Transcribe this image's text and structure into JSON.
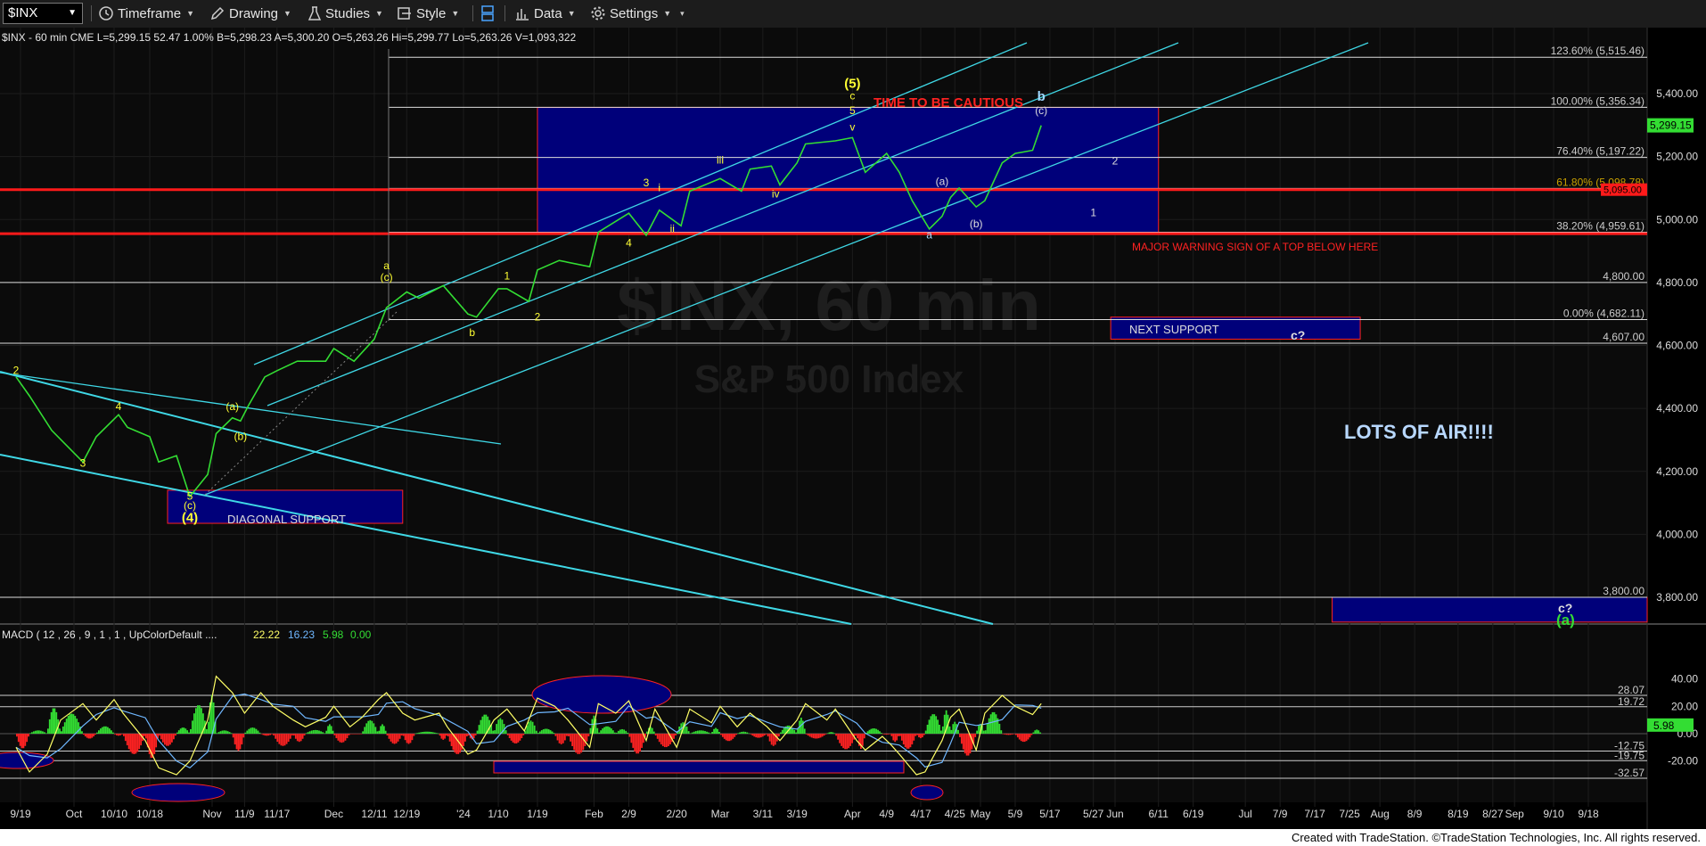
{
  "toolbar": {
    "symbol": "$INX",
    "timeframe_label": "Timeframe",
    "drawing_label": "Drawing",
    "studies_label": "Studies",
    "style_label": "Style",
    "data_label": "Data",
    "settings_label": "Settings",
    "icons": [
      "clock-icon",
      "pencil-icon",
      "flask-icon",
      "style-icon",
      "layout-icon",
      "bar-chart-icon",
      "gear-icon"
    ]
  },
  "header": {
    "info_line": "$INX - 60 min  CME  L=5,299.15  52.47  1.00%  B=5,298.23  A=5,300.20  O=5,263.26  Hi=5,299.77  Lo=5,263.26  V=1,093,322"
  },
  "watermark": {
    "symbol": "$INX, 60 min",
    "name": "S&P 500 Index"
  },
  "chart_data": [
    {
      "type": "line",
      "title": "$INX - 60 min",
      "colors": {
        "price": "#33dd33",
        "fib_line": "#dddddd",
        "channel": "#3fd8e6",
        "support_line": "#ff1a1a",
        "box_fill": "#00007a",
        "box_border": "#ff2222"
      },
      "x_tick_labels": [
        "9/19",
        "Oct",
        "10/10",
        "10/18",
        "Nov",
        "11/9",
        "11/17",
        "Dec",
        "12/11",
        "12/19",
        "'24",
        "1/10",
        "1/19",
        "Feb",
        "2/9",
        "2/20",
        "Mar",
        "3/11",
        "3/19",
        "Apr",
        "4/9",
        "4/17",
        "4/25",
        "May",
        "5/9",
        "5/17",
        "5/27",
        "Jun",
        "6/11",
        "6/19",
        "Jul",
        "7/9",
        "7/17",
        "7/25",
        "Aug",
        "8/9",
        "8/19",
        "8/27",
        "Sep",
        "9/10",
        "9/18"
      ],
      "y_axis_labels": [
        "5,400.00",
        "5,200.00",
        "5,000.00",
        "4,800.00",
        "4,600.00",
        "4,400.00",
        "4,200.00",
        "4,000.00",
        "3,800.00"
      ],
      "ylim": [
        3720,
        5600
      ],
      "last_price": 5299.15,
      "last_price_label": "5,299.15",
      "fib_levels": [
        {
          "value": 5515.46,
          "label": "123.60% (5,515.46)"
        },
        {
          "value": 5356.34,
          "label": "100.00% (5,356.34)"
        },
        {
          "value": 5197.22,
          "label": "76.40% (5,197.22)"
        },
        {
          "value": 5098.78,
          "label": "61.80% (5,098.78)"
        },
        {
          "value": 4959.61,
          "label": "38.20% (4,959.61)"
        },
        {
          "value": 4682.11,
          "label": "0.00% (4,682.11)"
        }
      ],
      "level_labels": [
        {
          "value": 4800,
          "label": "4,800.00"
        },
        {
          "value": 4607,
          "label": "4,607.00"
        },
        {
          "value": 3800,
          "label": "3,800.00"
        }
      ],
      "red_support_lines": [
        5095,
        4955
      ],
      "red_line_tag": "5,095.00",
      "wave_labels": [
        {
          "text": "(5)",
          "date": "4/1",
          "y": 5418,
          "color": "#ffff33"
        },
        {
          "text": "c",
          "date": "4/1",
          "y": 5382,
          "color": "#ffff33"
        },
        {
          "text": "5",
          "date": "4/1",
          "y": 5335,
          "color": "#ffff33"
        },
        {
          "text": "v",
          "date": "4/1",
          "y": 5282,
          "color": "#ffff33"
        },
        {
          "text": "iii",
          "date": "3/1",
          "y": 5178,
          "color": "#ffff33"
        },
        {
          "text": "iv",
          "date": "3/14",
          "y": 5070,
          "color": "#ffff33"
        },
        {
          "text": "i",
          "date": "2/16",
          "y": 5090,
          "color": "#ffff33"
        },
        {
          "text": "3",
          "date": "2/13",
          "y": 5105,
          "color": "#ffff33"
        },
        {
          "text": "4",
          "date": "2/9",
          "y": 4915,
          "color": "#ffff33"
        },
        {
          "text": "ii",
          "date": "2/19",
          "y": 4960,
          "color": "#ffff33"
        },
        {
          "text": "1",
          "date": "1/12",
          "y": 4810,
          "color": "#ffff33"
        },
        {
          "text": "2",
          "date": "1/19",
          "y": 4680,
          "color": "#ffff33"
        },
        {
          "text": "a",
          "date": "12/14",
          "y": 4842,
          "color": "#ffff33"
        },
        {
          "text": "(c)",
          "date": "12/14",
          "y": 4805,
          "color": "#ffff33"
        },
        {
          "text": "b",
          "date": "1/4",
          "y": 4630,
          "color": "#ffff33"
        },
        {
          "text": "(a)",
          "date": "11/6",
          "y": 4395,
          "color": "#ffff33"
        },
        {
          "text": "(b)",
          "date": "11/8",
          "y": 4300,
          "color": "#ffff33"
        },
        {
          "text": "4",
          "date": "10/11",
          "y": 4395,
          "color": "#ffff33"
        },
        {
          "text": "3",
          "date": "10/3",
          "y": 4215,
          "color": "#ffff33"
        },
        {
          "text": "2",
          "date": "9/18",
          "y": 4510,
          "color": "#ffff33"
        },
        {
          "text": "5",
          "date": "10/27",
          "y": 4110,
          "color": "#ffff33"
        },
        {
          "text": "(c)",
          "date": "10/27",
          "y": 4080,
          "color": "#ffff33"
        },
        {
          "text": "(4)",
          "date": "10/27",
          "y": 4040,
          "color": "#ffff33"
        },
        {
          "text": "a",
          "date": "4/19",
          "y": 4940,
          "color": "#9fd8ff"
        },
        {
          "text": "(a)",
          "date": "4/22",
          "y": 5110,
          "color": "#dddddd"
        },
        {
          "text": "(b)",
          "date": "4/30",
          "y": 4975,
          "color": "#dddddd"
        },
        {
          "text": "(c)",
          "date": "5/15",
          "y": 5335,
          "color": "#dddddd"
        },
        {
          "text": "b",
          "date": "5/15",
          "y": 5378,
          "color": "#9fd8ff"
        },
        {
          "text": "2",
          "date": "6/1",
          "y": 5175,
          "color": "#dddddd"
        },
        {
          "text": "1",
          "date": "5/27",
          "y": 5010,
          "color": "#dddddd"
        }
      ],
      "annotations": [
        {
          "text": "TIME TO BE CAUTIOUS",
          "color": "#ff2222"
        },
        {
          "text": "MAJOR WARNING SIGN OF A TOP BELOW HERE",
          "color": "#ff2222"
        },
        {
          "text": "NEXT SUPPORT",
          "color": "#dddddd"
        },
        {
          "text": "c?",
          "color": "#dddddd"
        },
        {
          "text": "LOTS OF AIR!!!!",
          "color": "#b8d8ff"
        },
        {
          "text": "DIAGONAL SUPPORT",
          "color": "#dddddd"
        },
        {
          "text": "c?",
          "color": "#dddddd"
        },
        {
          "text": "(a)",
          "color": "#33dd33"
        }
      ],
      "price_points": [
        [
          "9/18",
          4500
        ],
        [
          "9/21",
          4440
        ],
        [
          "9/26",
          4330
        ],
        [
          "10/3",
          4230
        ],
        [
          "10/6",
          4310
        ],
        [
          "10/11",
          4380
        ],
        [
          "10/13",
          4340
        ],
        [
          "10/18",
          4310
        ],
        [
          "10/20",
          4230
        ],
        [
          "10/24",
          4250
        ],
        [
          "10/27",
          4120
        ],
        [
          "10/31",
          4190
        ],
        [
          "11/2",
          4320
        ],
        [
          "11/6",
          4370
        ],
        [
          "11/8",
          4360
        ],
        [
          "11/10",
          4410
        ],
        [
          "11/14",
          4500
        ],
        [
          "11/17",
          4520
        ],
        [
          "11/22",
          4550
        ],
        [
          "11/29",
          4550
        ],
        [
          "12/1",
          4590
        ],
        [
          "12/6",
          4550
        ],
        [
          "12/11",
          4620
        ],
        [
          "12/14",
          4720
        ],
        [
          "12/19",
          4770
        ],
        [
          "12/22",
          4750
        ],
        [
          "12/28",
          4790
        ],
        [
          "1/3",
          4700
        ],
        [
          "1/5",
          4690
        ],
        [
          "1/10",
          4780
        ],
        [
          "1/12",
          4780
        ],
        [
          "1/17",
          4740
        ],
        [
          "1/19",
          4840
        ],
        [
          "1/24",
          4870
        ],
        [
          "1/31",
          4850
        ],
        [
          "2/2",
          4960
        ],
        [
          "2/9",
          5020
        ],
        [
          "2/13",
          4950
        ],
        [
          "2/16",
          5030
        ],
        [
          "2/21",
          4980
        ],
        [
          "2/23",
          5090
        ],
        [
          "3/1",
          5130
        ],
        [
          "3/6",
          5090
        ],
        [
          "3/8",
          5160
        ],
        [
          "3/13",
          5170
        ],
        [
          "3/15",
          5110
        ],
        [
          "3/19",
          5180
        ],
        [
          "3/21",
          5240
        ],
        [
          "3/28",
          5250
        ],
        [
          "4/1",
          5260
        ],
        [
          "4/4",
          5150
        ],
        [
          "4/9",
          5210
        ],
        [
          "4/12",
          5150
        ],
        [
          "4/15",
          5060
        ],
        [
          "4/19",
          4970
        ],
        [
          "4/22",
          5010
        ],
        [
          "4/24",
          5070
        ],
        [
          "4/26",
          5100
        ],
        [
          "4/30",
          5040
        ],
        [
          "5/2",
          5060
        ],
        [
          "5/6",
          5180
        ],
        [
          "5/9",
          5210
        ],
        [
          "5/13",
          5220
        ],
        [
          "5/15",
          5299
        ]
      ]
    },
    {
      "type": "line",
      "title": "MACD ( 12 , 26 , 9 , 1 , 1 , UpColorDefault ....",
      "legend_values": [
        {
          "text": "22.22",
          "color": "#ffff66"
        },
        {
          "text": "16.23",
          "color": "#6fb7ff"
        },
        {
          "text": "5.98",
          "color": "#33dd33"
        },
        {
          "text": "0.00",
          "color": "#33dd33"
        }
      ],
      "y_axis_labels": [
        "40.00",
        "20.00",
        "0.00",
        "-20.00"
      ],
      "ylim": [
        -32,
        46
      ],
      "level_labels": [
        {
          "value": 28.07,
          "label": "28.07"
        },
        {
          "value": 19.72,
          "label": "19.72"
        },
        {
          "value": -12.75,
          "label": "-12.75"
        },
        {
          "value": -19.75,
          "label": "-19.75"
        },
        {
          "value": -32.57,
          "label": "-32.57"
        }
      ],
      "current_value_label": "5.98",
      "series": [
        {
          "name": "MACD",
          "color": "#ffff66"
        },
        {
          "name": "Signal",
          "color": "#6fb7ff"
        },
        {
          "name": "Histogram",
          "color": "#33dd33"
        }
      ],
      "macd_points": [
        [
          "9/18",
          -10
        ],
        [
          "9/21",
          -28
        ],
        [
          "9/25",
          -15
        ],
        [
          "9/28",
          10
        ],
        [
          "10/3",
          22
        ],
        [
          "10/6",
          10
        ],
        [
          "10/10",
          25
        ],
        [
          "10/12",
          15
        ],
        [
          "10/17",
          -5
        ],
        [
          "10/20",
          -25
        ],
        [
          "10/24",
          -30
        ],
        [
          "10/27",
          -20
        ],
        [
          "10/31",
          10
        ],
        [
          "11/2",
          42
        ],
        [
          "11/6",
          30
        ],
        [
          "11/9",
          15
        ],
        [
          "11/13",
          30
        ],
        [
          "11/16",
          20
        ],
        [
          "11/21",
          10
        ],
        [
          "11/24",
          5
        ],
        [
          "11/29",
          12
        ],
        [
          "12/1",
          20
        ],
        [
          "12/5",
          5
        ],
        [
          "12/8",
          12
        ],
        [
          "12/12",
          25
        ],
        [
          "12/14",
          30
        ],
        [
          "12/18",
          15
        ],
        [
          "12/21",
          10
        ],
        [
          "12/27",
          15
        ],
        [
          "12/29",
          5
        ],
        [
          "1/3",
          -15
        ],
        [
          "1/5",
          -12
        ],
        [
          "1/9",
          10
        ],
        [
          "1/12",
          18
        ],
        [
          "1/16",
          2
        ],
        [
          "1/19",
          26
        ],
        [
          "1/23",
          20
        ],
        [
          "1/26",
          10
        ],
        [
          "1/31",
          -10
        ],
        [
          "2/2",
          22
        ],
        [
          "2/6",
          15
        ],
        [
          "2/9",
          24
        ],
        [
          "2/13",
          -5
        ],
        [
          "2/15",
          18
        ],
        [
          "2/20",
          -10
        ],
        [
          "2/23",
          18
        ],
        [
          "2/28",
          8
        ],
        [
          "3/1",
          20
        ],
        [
          "3/5",
          5
        ],
        [
          "3/8",
          15
        ],
        [
          "3/12",
          5
        ],
        [
          "3/15",
          -5
        ],
        [
          "3/19",
          10
        ],
        [
          "3/21",
          22
        ],
        [
          "3/26",
          10
        ],
        [
          "3/28",
          18
        ],
        [
          "4/2",
          -5
        ],
        [
          "4/4",
          -12
        ],
        [
          "4/8",
          -2
        ],
        [
          "4/10",
          -8
        ],
        [
          "4/12",
          -15
        ],
        [
          "4/16",
          -30
        ],
        [
          "4/18",
          -28
        ],
        [
          "4/22",
          -5
        ],
        [
          "4/24",
          12
        ],
        [
          "4/26",
          18
        ],
        [
          "4/30",
          -12
        ],
        [
          "5/2",
          15
        ],
        [
          "5/6",
          28
        ],
        [
          "5/9",
          20
        ],
        [
          "5/13",
          14
        ],
        [
          "5/15",
          22
        ]
      ]
    }
  ],
  "footer": {
    "credit": "Created with TradeStation. ©TradeStation Technologies, Inc. All rights reserved."
  }
}
